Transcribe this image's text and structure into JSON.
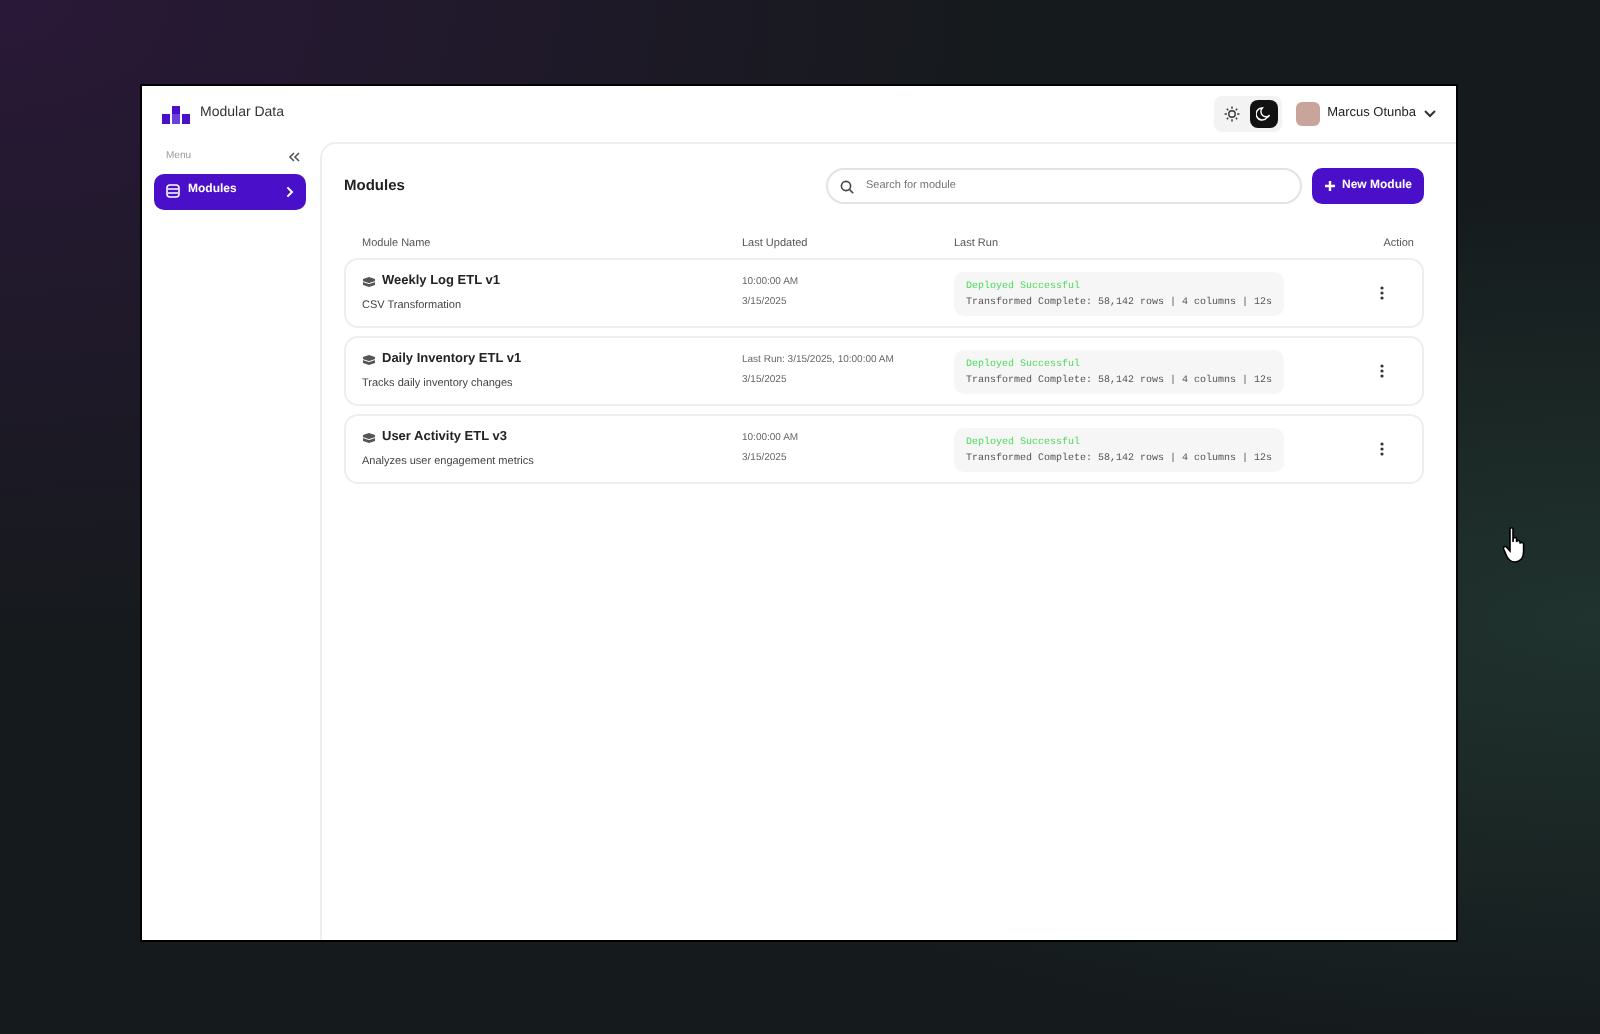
{
  "app": {
    "title": "Modular Data"
  },
  "theme_toggle": [
    {
      "kind": "light",
      "selected": false
    },
    {
      "kind": "dark",
      "selected": true
    }
  ],
  "user": {
    "name": "Marcus Otunba"
  },
  "sidebar": {
    "heading": "Menu",
    "items": [
      {
        "label": "Modules",
        "selected": true
      }
    ]
  },
  "page": {
    "title": "Modules",
    "search": {
      "placeholder": "Search for module"
    },
    "new_button": "New Module"
  },
  "table": {
    "columns": [
      "Module Name",
      "Last Updated",
      "Last Run",
      "Action"
    ],
    "rows": [
      {
        "name": "Weekly Log ETL v1",
        "description": "CSV Transformation",
        "updated": "10:00:00 AM",
        "date": "3/15/2025",
        "status": "Deployed Successful",
        "details": "Transformed Complete: 58,142 rows | 4 columns | 12s"
      },
      {
        "name": "Daily Inventory ETL v1",
        "description": "Tracks daily inventory changes",
        "updated": "Last Run: 3/15/2025, 10:00:00 AM",
        "date": "3/15/2025",
        "status": "Deployed Successful",
        "details": "Transformed Complete: 58,142 rows | 4 columns | 12s"
      },
      {
        "name": "User Activity ETL v3",
        "description": "Analyzes user engagement metrics",
        "updated": "10:00:00 AM",
        "date": "3/15/2025",
        "status": "Deployed Successful",
        "details": "Transformed Complete: 58,142 rows | 4 columns | 12s"
      }
    ]
  }
}
